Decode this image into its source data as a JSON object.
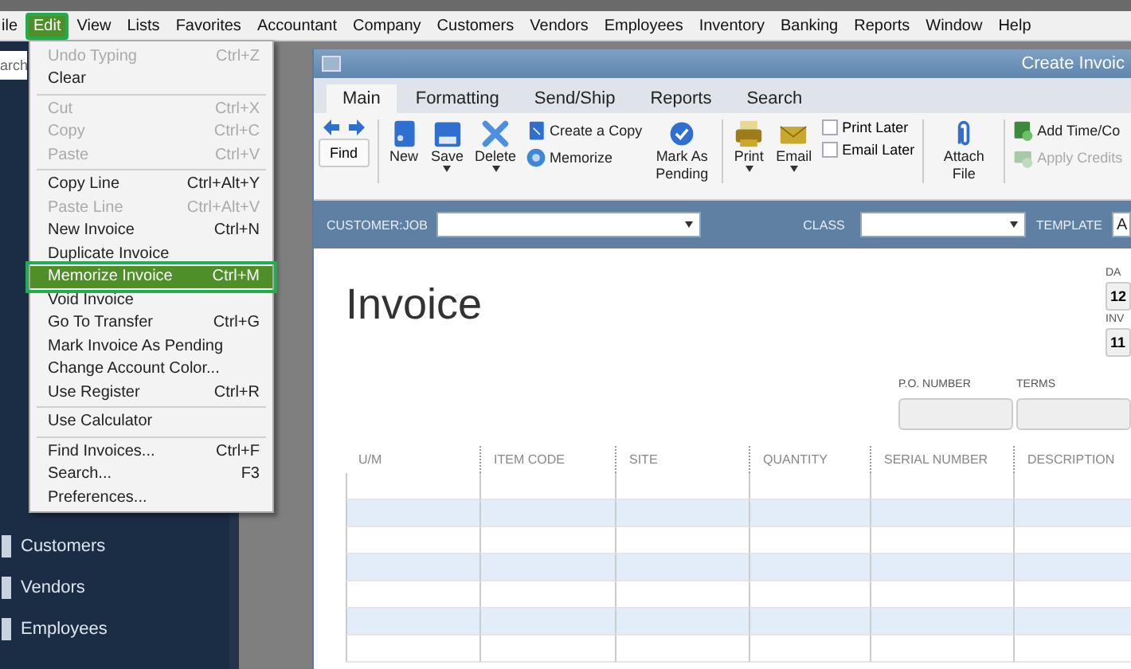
{
  "menu_bar": [
    {
      "label": "ile",
      "selected": false
    },
    {
      "label": "Edit",
      "selected": true
    },
    {
      "label": "View",
      "selected": false
    },
    {
      "label": "Lists",
      "selected": false
    },
    {
      "label": "Favorites",
      "selected": false
    },
    {
      "label": "Accountant",
      "selected": false
    },
    {
      "label": "Company",
      "selected": false
    },
    {
      "label": "Customers",
      "selected": false
    },
    {
      "label": "Vendors",
      "selected": false
    },
    {
      "label": "Employees",
      "selected": false
    },
    {
      "label": "Inventory",
      "selected": false
    },
    {
      "label": "Banking",
      "selected": false
    },
    {
      "label": "Reports",
      "selected": false
    },
    {
      "label": "Window",
      "selected": false
    },
    {
      "label": "Help",
      "selected": false
    }
  ],
  "edit_menu": [
    {
      "kind": "item",
      "label": "Undo Typing",
      "shortcut": "Ctrl+Z",
      "disabled": true,
      "selected": false
    },
    {
      "kind": "item",
      "label": "Clear",
      "disabled": false,
      "selected": false
    },
    {
      "kind": "separator"
    },
    {
      "kind": "item",
      "label": "Cut",
      "shortcut": "Ctrl+X",
      "disabled": true,
      "selected": false
    },
    {
      "kind": "item",
      "label": "Copy",
      "shortcut": "Ctrl+C",
      "disabled": true,
      "selected": false
    },
    {
      "kind": "item",
      "label": "Paste",
      "shortcut": "Ctrl+V",
      "disabled": true,
      "selected": false
    },
    {
      "kind": "separator"
    },
    {
      "kind": "item",
      "label": "Copy Line",
      "shortcut": "Ctrl+Alt+Y",
      "disabled": false,
      "selected": false
    },
    {
      "kind": "item",
      "label": "Paste Line",
      "shortcut": "Ctrl+Alt+V",
      "disabled": true,
      "selected": false
    },
    {
      "kind": "item",
      "label": "New Invoice",
      "shortcut": "Ctrl+N",
      "disabled": false,
      "selected": false
    },
    {
      "kind": "item",
      "label": "Duplicate Invoice",
      "disabled": false,
      "selected": false
    },
    {
      "kind": "item",
      "label": "Memorize Invoice",
      "shortcut": "Ctrl+M",
      "disabled": false,
      "selected": true
    },
    {
      "kind": "item",
      "label": "Void Invoice",
      "disabled": false,
      "selected": false
    },
    {
      "kind": "item",
      "label": "Go To Transfer",
      "shortcut": "Ctrl+G",
      "disabled": false,
      "selected": false
    },
    {
      "kind": "item",
      "label": "Mark Invoice As Pending",
      "disabled": false,
      "selected": false
    },
    {
      "kind": "item",
      "label": "Change Account Color...",
      "disabled": false,
      "selected": false
    },
    {
      "kind": "item",
      "label": "Use Register",
      "shortcut": "Ctrl+R",
      "disabled": false,
      "selected": false
    },
    {
      "kind": "separator"
    },
    {
      "kind": "item",
      "label": "Use Calculator",
      "disabled": false,
      "selected": false
    },
    {
      "kind": "separator"
    },
    {
      "kind": "item",
      "label": "Find Invoices...",
      "shortcut": "Ctrl+F",
      "disabled": false,
      "selected": false
    },
    {
      "kind": "item",
      "label": "Search...",
      "shortcut": "F3",
      "disabled": false,
      "selected": false
    },
    {
      "kind": "item",
      "label": "Preferences...",
      "disabled": false,
      "selected": false
    }
  ],
  "sidebar": {
    "search_placeholder": "arch",
    "items": [
      "Customers",
      "Vendors",
      "Employees"
    ]
  },
  "invoice_window": {
    "title": "Create Invoic",
    "tabs": [
      {
        "label": "Main",
        "selected": true
      },
      {
        "label": "Formatting",
        "selected": false
      },
      {
        "label": "Send/Ship",
        "selected": false
      },
      {
        "label": "Reports",
        "selected": false
      },
      {
        "label": "Search",
        "selected": false
      }
    ],
    "toolbar": [
      {
        "kind": "find",
        "label": "Find"
      },
      {
        "kind": "sep"
      },
      {
        "kind": "big",
        "label": "New",
        "dropdown": false
      },
      {
        "kind": "big",
        "label": "Save",
        "dropdown": true
      },
      {
        "kind": "big",
        "label": "Delete",
        "dropdown": true
      },
      {
        "kind": "pair",
        "items": [
          {
            "label": "Create a Copy",
            "disabled": false
          },
          {
            "label": "Memorize",
            "disabled": false
          }
        ]
      },
      {
        "kind": "big",
        "label": "Mark As Pending",
        "dropdown": false
      },
      {
        "kind": "sep"
      },
      {
        "kind": "big",
        "label": "Print",
        "dropdown": true
      },
      {
        "kind": "big",
        "label": "Email",
        "dropdown": true
      },
      {
        "kind": "checks",
        "items": [
          {
            "label": "Print Later",
            "checked": false
          },
          {
            "label": "Email Later",
            "checked": false
          }
        ]
      },
      {
        "kind": "sep"
      },
      {
        "kind": "big",
        "label": "Attach File",
        "dropdown": false
      },
      {
        "kind": "sep"
      },
      {
        "kind": "pair",
        "items": [
          {
            "label": "Add Time/Co",
            "disabled": false
          },
          {
            "label": "Apply Credits",
            "disabled": true
          }
        ]
      }
    ],
    "customer_job_label": "CUSTOMER:JOB",
    "class_label": "CLASS",
    "template_label": "TEMPLATE",
    "template_value": "A",
    "heading": "Invoice",
    "date_label": "DA",
    "date_value": "12",
    "invoice_no_label": "INV",
    "invoice_no_value": "11",
    "po_number_label": "P.O. NUMBER",
    "terms_label": "TERMS",
    "table": {
      "columns": [
        "U/M",
        "ITEM CODE",
        "SITE",
        "QUANTITY",
        "SERIAL NUMBER",
        "DESCRIPTION"
      ]
    }
  }
}
